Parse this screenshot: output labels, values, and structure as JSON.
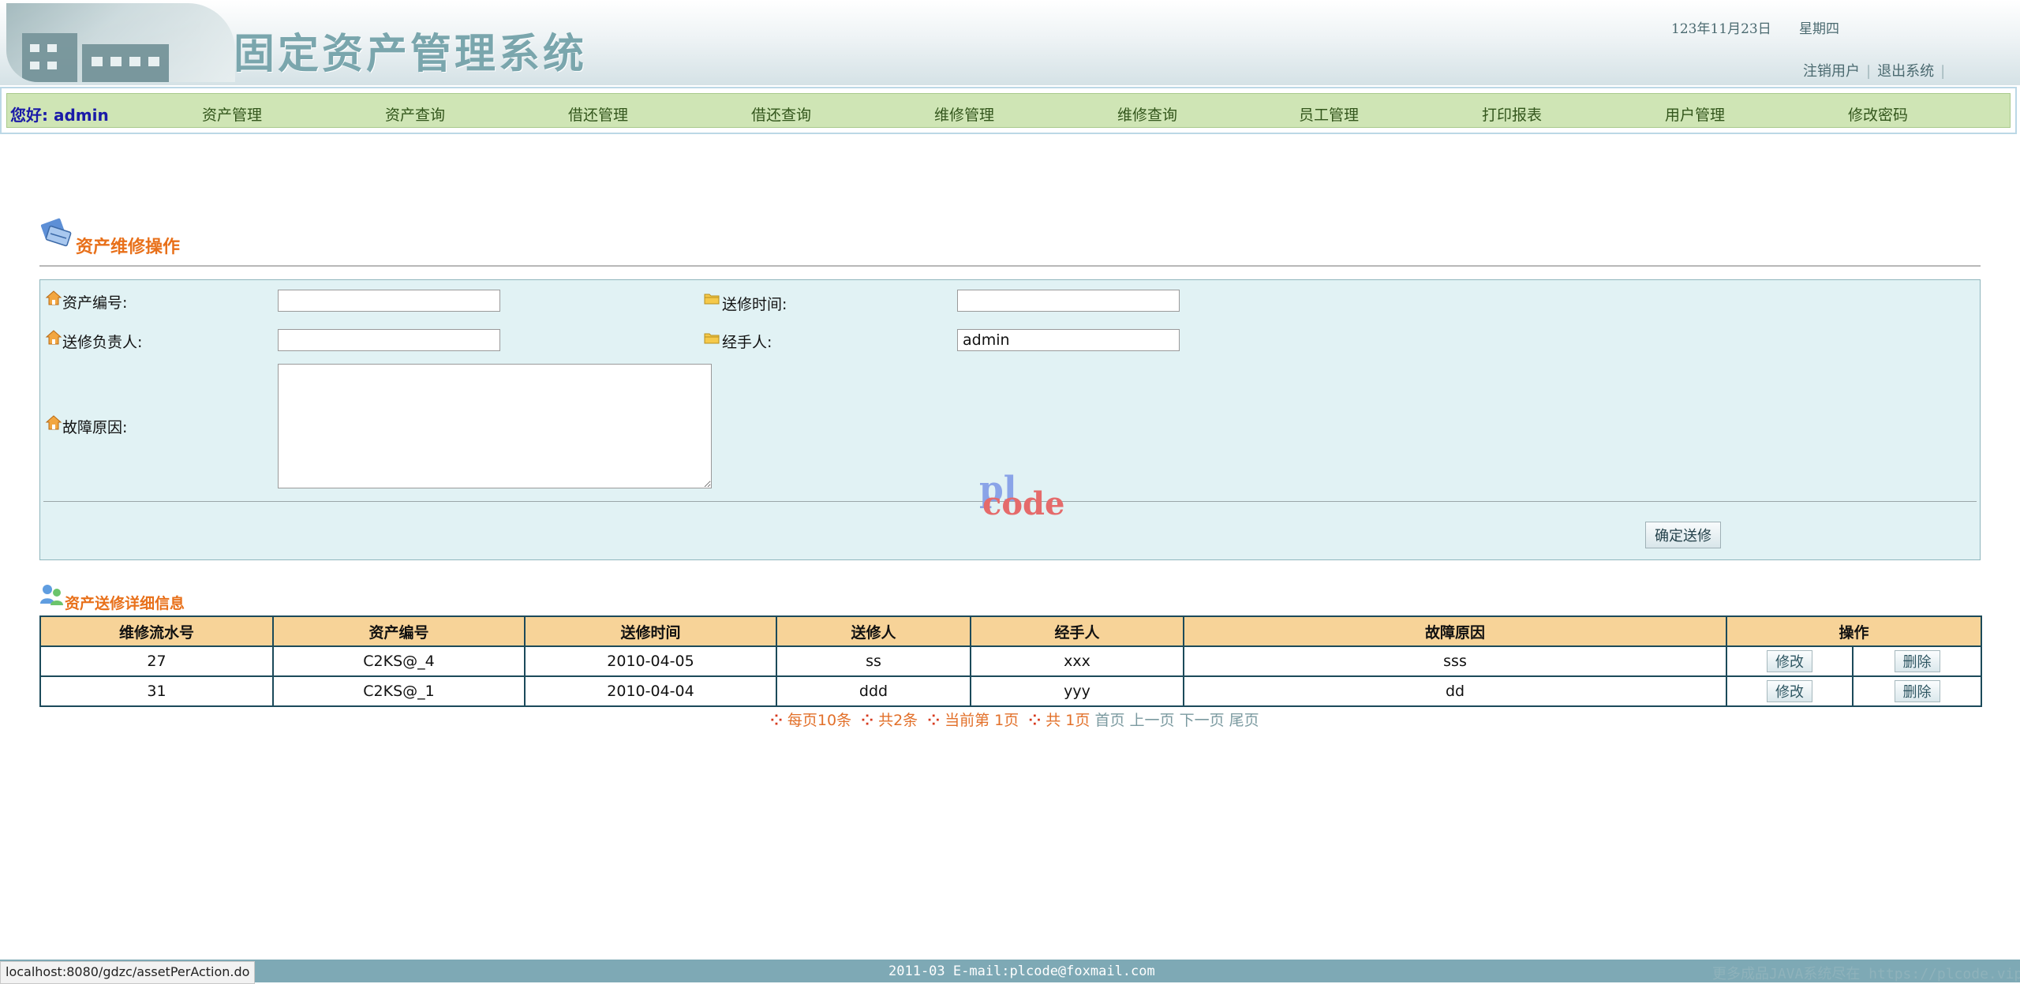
{
  "header": {
    "title": "固定资产管理系统",
    "date": "123年11月23日",
    "weekday": "星期四",
    "links": [
      "注销用户",
      "退出系统"
    ]
  },
  "nav": {
    "greeting": "您好: admin",
    "items": [
      "资产管理",
      "资产查询",
      "借还管理",
      "借还查询",
      "维修管理",
      "维修查询",
      "员工管理",
      "打印报表",
      "用户管理",
      "修改密码"
    ]
  },
  "repair_form": {
    "title": "资产维修操作",
    "labels": {
      "asset_no": "资产编号:",
      "send_time": "送修时间:",
      "responsible": "送修负责人:",
      "handler": "经手人:",
      "fault_reason": "故障原因:"
    },
    "values": {
      "asset_no": "",
      "send_time": "",
      "responsible": "",
      "handler": "admin",
      "fault_reason": ""
    },
    "submit_label": "确定送修",
    "watermark": {
      "top": "pl",
      "bottom": "code"
    }
  },
  "detail_table": {
    "title": "资产送修详细信息",
    "columns": [
      "维修流水号",
      "资产编号",
      "送修时间",
      "送修人",
      "经手人",
      "故障原因",
      "操作"
    ],
    "rows": [
      {
        "id": "27",
        "asset_no": "C2KS@_4",
        "time": "2010-04-05",
        "sender": "ss",
        "handler": "xxx",
        "reason": "sss",
        "edit": "修改",
        "delete": "删除"
      },
      {
        "id": "31",
        "asset_no": "C2KS@_1",
        "time": "2010-04-04",
        "sender": "ddd",
        "handler": "yyy",
        "reason": "dd",
        "edit": "修改",
        "delete": "删除"
      }
    ]
  },
  "pager": {
    "per_page": "每页10条",
    "total": "共2条",
    "current": "当前第 1页",
    "pages": "共 1页",
    "first": "首页",
    "prev": "上一页",
    "next": "下一页",
    "last": "尾页"
  },
  "footer": {
    "text": "2011-03 E-mail:plcode@foxmail.com",
    "right_text": "更多成品JAVA系统尽在 https://plcode.vip"
  },
  "status_bar": {
    "url": "localhost:8080/gdzc/assetPerAction.do"
  },
  "colors": {
    "nav_bg": "#cfe5b5",
    "panel_bg": "#e1f2f4",
    "table_header_bg": "#f7d398",
    "title_orange": "#e8701a",
    "footer_bg": "#7ea9b5"
  }
}
